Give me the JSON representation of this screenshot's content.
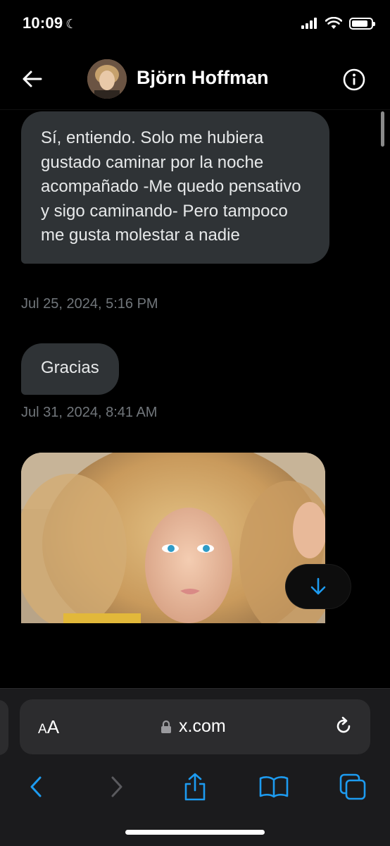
{
  "status_bar": {
    "time": "10:09",
    "moon_glyph": "☾",
    "battery_level": 0.85
  },
  "header": {
    "contact_name": "Björn Hoffman"
  },
  "messages": [
    {
      "text": "Sí, entiendo. Solo me hubiera gustado caminar por la noche acompañado -Me quedo pensativo y sigo caminando- Pero tampoco me gusta molestar a nadie",
      "timestamp": "Jul 25, 2024, 5:16 PM"
    },
    {
      "text": "Gracias",
      "timestamp": "Jul 31, 2024, 8:41 AM"
    }
  ],
  "image_message": {
    "icon": "photo"
  },
  "safari": {
    "text_size_small": "A",
    "text_size_large": "A",
    "url": "x.com"
  },
  "colors": {
    "accent": "#1d9bf0",
    "bubble": "#2f3336",
    "timestamp": "#71767b"
  }
}
